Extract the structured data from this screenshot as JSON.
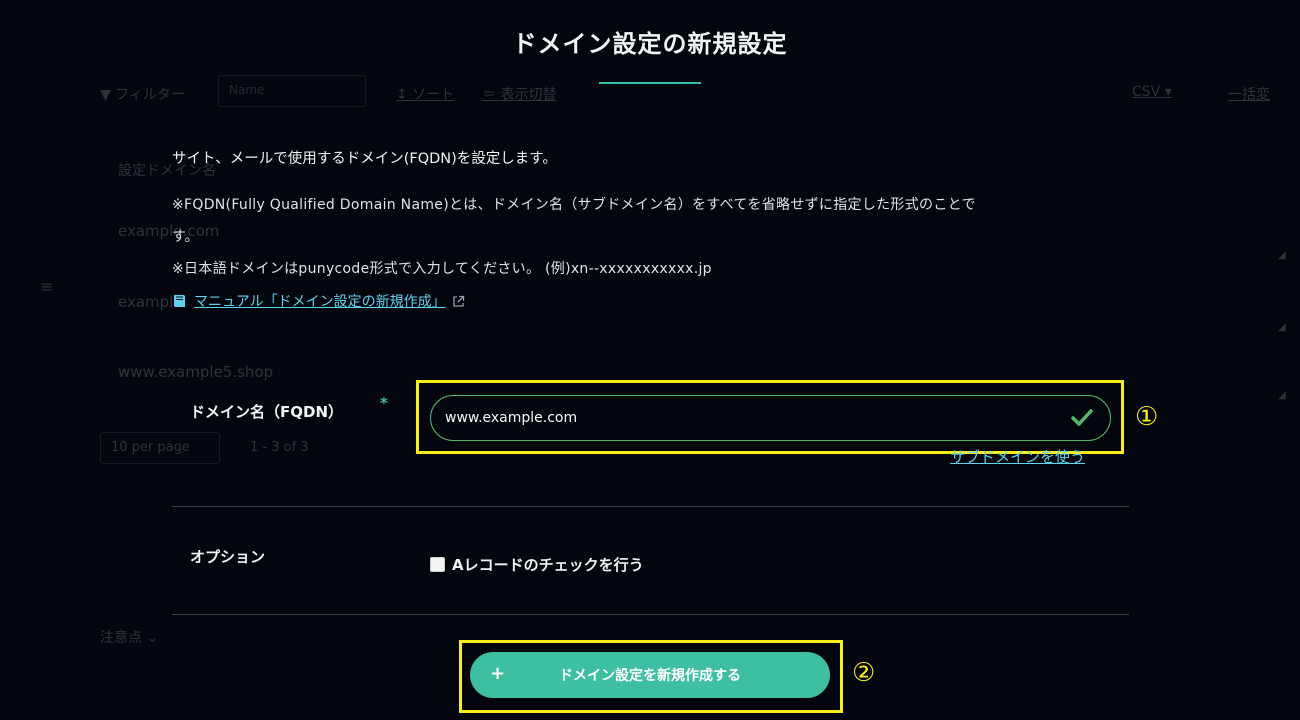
{
  "background": {
    "filter_label": "▼ フィルター",
    "name_placeholder": "Name",
    "sort_label": "↕ ソート",
    "view_toggle_label": "＝ 表示切替",
    "csv_label": "CSV ▾",
    "bulk_label": "一括変",
    "column_header": "設定ドメイン名",
    "rows": [
      "example.com",
      "example",
      "www.example5.shop"
    ],
    "per_page": "10 per page",
    "range": "1 - 3 of 3",
    "notes_label": "注意点 ⌄"
  },
  "modal": {
    "title": "ドメイン設定の新規設定",
    "lead": "サイト、メールで使用するドメイン(FQDN)を設定します。",
    "note_fqdn_line1": "※FQDN(Fully Qualified Domain Name)とは、ドメイン名（サブドメイン名）をすべてを省略せずに指定した形式のことで",
    "note_fqdn_line2": "す。",
    "note_punycode": "※日本語ドメインはpunycode形式で入力してください。 (例)xn--xxxxxxxxxxx.jp",
    "manual_link": "マニュアル「ドメイン設定の新規作成」",
    "domain_label": "ドメイン名（FQDN）",
    "required_mark": "*",
    "domain_value": "www.example.com",
    "subdomain_link": "サブドメインを使う",
    "option_label": "オプション",
    "a_record_label": "Aレコードのチェックを行う",
    "create_button": "ドメイン設定を新規作成する",
    "create_plus": "+"
  },
  "annotations": {
    "step1": "①",
    "step2": "②"
  },
  "colors": {
    "accent": "#3fbfa1",
    "link": "#5ed3ef",
    "highlight": "#f7ef1c",
    "valid": "#58b86a"
  }
}
